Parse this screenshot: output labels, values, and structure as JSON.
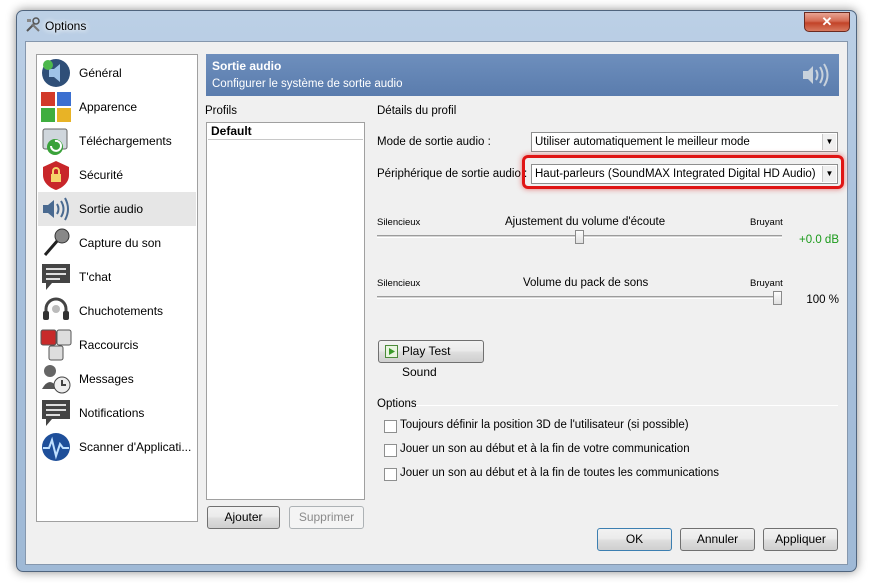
{
  "window": {
    "title": "Options",
    "close_label": "✕"
  },
  "sidebar": {
    "items": [
      {
        "label": "Général",
        "icon": "speaker-general-icon"
      },
      {
        "label": "Apparence",
        "icon": "appearance-palette-icon"
      },
      {
        "label": "Téléchargements",
        "icon": "download-icon"
      },
      {
        "label": "Sécurité",
        "icon": "security-lock-icon"
      },
      {
        "label": "Sortie audio",
        "icon": "speaker-output-icon",
        "active": true
      },
      {
        "label": "Capture du son",
        "icon": "microphone-icon"
      },
      {
        "label": "T'chat",
        "icon": "chat-icon"
      },
      {
        "label": "Chuchotements",
        "icon": "headset-icon"
      },
      {
        "label": "Raccourcis",
        "icon": "hotkeys-icon"
      },
      {
        "label": "Messages",
        "icon": "messages-icon"
      },
      {
        "label": "Notifications",
        "icon": "notifications-icon"
      },
      {
        "label": "Scanner d'Applicati...",
        "icon": "scanner-globe-icon"
      }
    ]
  },
  "header": {
    "title": "Sortie audio",
    "subtitle": "Configurer le système de sortie audio"
  },
  "profiles": {
    "label": "Profils",
    "items": [
      "Default"
    ],
    "add_label": "Ajouter",
    "remove_label": "Supprimer"
  },
  "details": {
    "label": "Détails du profil",
    "mode_label": "Mode de sortie audio :",
    "mode_value": "Utiliser automatiquement le meilleur mode",
    "device_label": "Périphérique de sortie audio :",
    "device_value": "Haut-parleurs (SoundMAX Integrated Digital HD Audio)",
    "volume": {
      "left": "Silencieux",
      "title": "Ajustement du volume d'écoute",
      "right": "Bruyant",
      "value": "+0.0 dB",
      "level": 0.5
    },
    "sounds": {
      "left": "Silencieux",
      "title": "Volume du pack de sons",
      "right": "Bruyant",
      "value": "100 %",
      "level": 1.0
    },
    "test_button": "Play Test Sound"
  },
  "options": {
    "label": "Options",
    "items": [
      "Toujours définir la position 3D de l'utilisateur (si possible)",
      "Jouer un son au début et à la fin de votre communication",
      "Jouer un son au début et à la fin de toutes les communications"
    ]
  },
  "footer": {
    "ok": "OK",
    "cancel": "Annuler",
    "apply": "Appliquer"
  },
  "colors": {
    "header": "#5f81b1",
    "highlight": "#e01515",
    "green_value": "#1a9a1a"
  }
}
